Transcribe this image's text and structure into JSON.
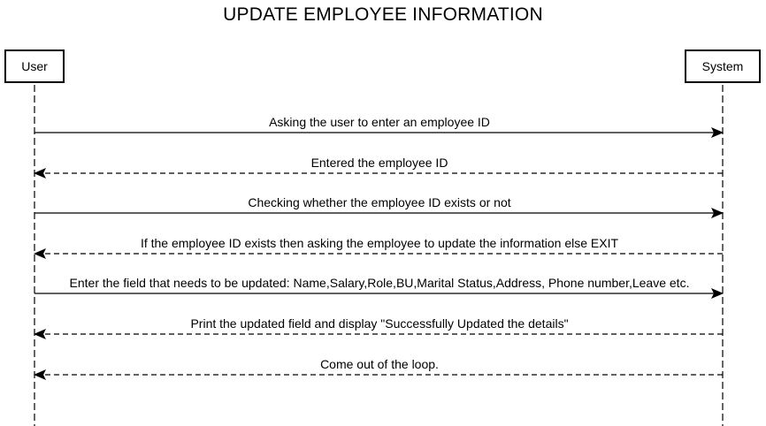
{
  "title": "UPDATE EMPLOYEE INFORMATION",
  "participants": {
    "user": "User",
    "system": "System"
  },
  "messages": [
    {
      "text": "Asking the user to enter an employee ID",
      "from": "user",
      "to": "system",
      "style": "solid"
    },
    {
      "text": "Entered the employee ID",
      "from": "system",
      "to": "user",
      "style": "dashed"
    },
    {
      "text": "Checking whether the employee ID exists or not",
      "from": "user",
      "to": "system",
      "style": "solid"
    },
    {
      "text": "If the employee ID exists then asking the employee to update the information else EXIT",
      "from": "system",
      "to": "user",
      "style": "dashed"
    },
    {
      "text": "Enter the field that needs to be updated: Name,Salary,Role,BU,Marital Status,Address, Phone number,Leave etc.",
      "from": "user",
      "to": "system",
      "style": "solid"
    },
    {
      "text": "Print the updated field and display \"Successfully Updated the details\"",
      "from": "system",
      "to": "user",
      "style": "dashed"
    },
    {
      "text": "Come out of the loop.",
      "from": "system",
      "to": "user",
      "style": "dashed"
    }
  ],
  "colors": {
    "line": "#000000",
    "background": "#ffffff"
  }
}
